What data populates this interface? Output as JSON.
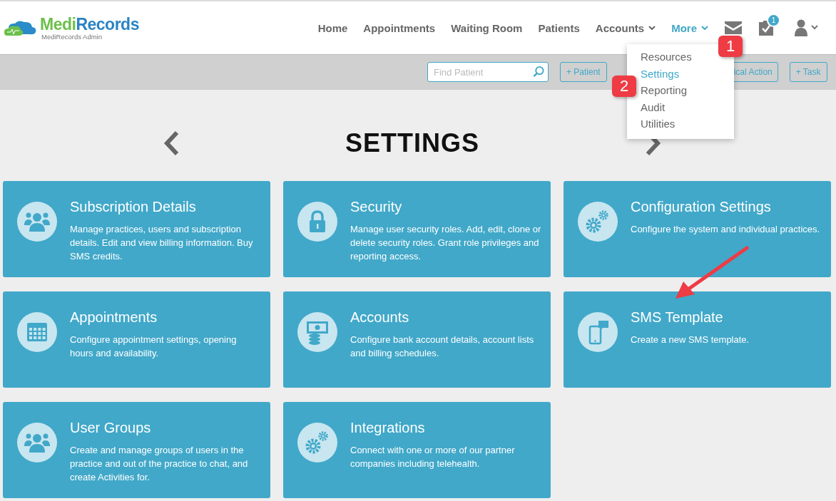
{
  "brand": {
    "name_part1": "Medi",
    "name_part2": "Records",
    "subtitle": "MediRecords Admin"
  },
  "nav": [
    {
      "label": "Home",
      "dropdown": false,
      "selected": false
    },
    {
      "label": "Appointments",
      "dropdown": false,
      "selected": false
    },
    {
      "label": "Waiting Room",
      "dropdown": false,
      "selected": false
    },
    {
      "label": "Patients",
      "dropdown": false,
      "selected": false
    },
    {
      "label": "Accounts",
      "dropdown": true,
      "selected": false
    },
    {
      "label": "More",
      "dropdown": true,
      "selected": true
    }
  ],
  "tasks_badge": "1",
  "more_menu": [
    {
      "label": "Resources",
      "selected": false
    },
    {
      "label": "Settings",
      "selected": true
    },
    {
      "label": "Reporting",
      "selected": false
    },
    {
      "label": "Audit",
      "selected": false
    },
    {
      "label": "Utilities",
      "selected": false
    }
  ],
  "search": {
    "placeholder": "Find Patient"
  },
  "toolbar_buttons": [
    "+ Patient",
    "ical Action",
    "+ Task"
  ],
  "page_title": "SETTINGS",
  "cards": [
    {
      "title": "Subscription Details",
      "description": "Manage practices, users and subscription details. Edit and view billing information. Buy SMS credits."
    },
    {
      "title": "Security",
      "description": "Manage user security roles. Add, edit, clone or delete security roles. Grant role privileges and reporting access."
    },
    {
      "title": "Configuration Settings",
      "description": "Configure the system and individual practices."
    },
    {
      "title": "Appointments",
      "description": "Configure appointment settings, opening hours and availability."
    },
    {
      "title": "Accounts",
      "description": "Configure bank account details, account lists and billing schedules."
    },
    {
      "title": "SMS Template",
      "description": "Create a new SMS template."
    },
    {
      "title": "User Groups",
      "description": "Create and manage groups of users in the practice and out of the practice to chat, and create Activities for."
    },
    {
      "title": "Integrations",
      "description": "Connect with one or more of our partner companies including telehealth."
    }
  ],
  "annotations": [
    "1",
    "2"
  ]
}
